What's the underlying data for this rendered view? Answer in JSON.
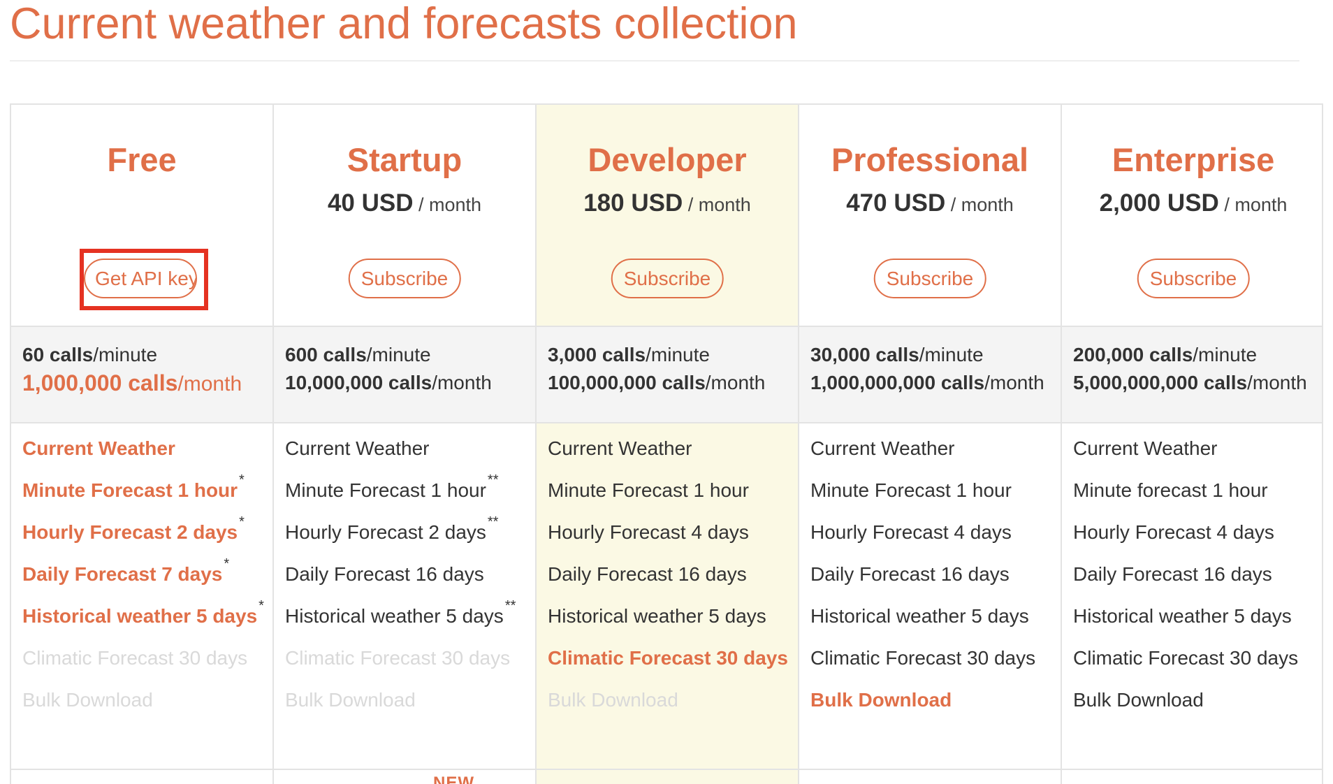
{
  "page": {
    "title": "Current weather and forecasts collection"
  },
  "colors": {
    "accent": "#e06f48",
    "featured_bg": "#fbf9e4",
    "highlight_box": "#e53222",
    "muted": "#d9d9d9"
  },
  "footer": {
    "badge": "NEW"
  },
  "plans": [
    {
      "name": "Free",
      "amount": "",
      "period": "",
      "button": "Get API key",
      "limits": [
        {
          "value": "60 calls",
          "unit": "/minute",
          "accent": false
        },
        {
          "value": "1,000,000 calls",
          "unit": "/month",
          "accent": true
        }
      ],
      "features": [
        {
          "text": "Current Weather",
          "mark": "",
          "state": "hl"
        },
        {
          "text": "Minute Forecast 1 hour",
          "mark": "*",
          "state": "hl"
        },
        {
          "text": "Hourly Forecast 2 days",
          "mark": "*",
          "state": "hl"
        },
        {
          "text": "Daily Forecast 7 days",
          "mark": "*",
          "state": "hl"
        },
        {
          "text": "Historical weather 5 days",
          "mark": "*",
          "state": "hl"
        },
        {
          "text": "Climatic Forecast 30 days",
          "mark": "",
          "state": "na"
        },
        {
          "text": "Bulk Download",
          "mark": "",
          "state": "na"
        }
      ]
    },
    {
      "name": "Startup",
      "amount": "40 USD",
      "period": "/ month",
      "button": "Subscribe",
      "limits": [
        {
          "value": "600 calls",
          "unit": "/minute",
          "accent": false
        },
        {
          "value": "10,000,000 calls",
          "unit": "/month",
          "accent": false
        }
      ],
      "features": [
        {
          "text": "Current Weather",
          "mark": "",
          "state": "ok"
        },
        {
          "text": "Minute Forecast 1 hour",
          "mark": "**",
          "state": "ok"
        },
        {
          "text": "Hourly Forecast 2 days",
          "mark": "**",
          "state": "ok"
        },
        {
          "text": "Daily Forecast 16 days",
          "mark": "",
          "state": "ok"
        },
        {
          "text": "Historical weather 5 days",
          "mark": "**",
          "state": "ok"
        },
        {
          "text": "Climatic Forecast 30 days",
          "mark": "",
          "state": "na"
        },
        {
          "text": "Bulk Download",
          "mark": "",
          "state": "na"
        }
      ]
    },
    {
      "name": "Developer",
      "amount": "180 USD",
      "period": "/ month",
      "button": "Subscribe",
      "limits": [
        {
          "value": "3,000 calls",
          "unit": "/minute",
          "accent": false
        },
        {
          "value": "100,000,000 calls",
          "unit": "/month",
          "accent": false
        }
      ],
      "features": [
        {
          "text": "Current Weather",
          "mark": "",
          "state": "ok"
        },
        {
          "text": "Minute Forecast 1 hour",
          "mark": "",
          "state": "ok"
        },
        {
          "text": "Hourly Forecast 4 days",
          "mark": "",
          "state": "ok"
        },
        {
          "text": "Daily Forecast 16 days",
          "mark": "",
          "state": "ok"
        },
        {
          "text": "Historical weather 5 days",
          "mark": "",
          "state": "ok"
        },
        {
          "text": "Climatic Forecast 30 days",
          "mark": "",
          "state": "hl"
        },
        {
          "text": "Bulk Download",
          "mark": "",
          "state": "na"
        }
      ]
    },
    {
      "name": "Professional",
      "amount": "470 USD",
      "period": "/ month",
      "button": "Subscribe",
      "limits": [
        {
          "value": "30,000 calls",
          "unit": "/minute",
          "accent": false
        },
        {
          "value": "1,000,000,000 calls",
          "unit": "/month",
          "accent": false
        }
      ],
      "features": [
        {
          "text": "Current Weather",
          "mark": "",
          "state": "ok"
        },
        {
          "text": "Minute Forecast 1 hour",
          "mark": "",
          "state": "ok"
        },
        {
          "text": "Hourly Forecast 4 days",
          "mark": "",
          "state": "ok"
        },
        {
          "text": "Daily Forecast 16 days",
          "mark": "",
          "state": "ok"
        },
        {
          "text": "Historical weather 5 days",
          "mark": "",
          "state": "ok"
        },
        {
          "text": "Climatic Forecast 30 days",
          "mark": "",
          "state": "ok"
        },
        {
          "text": "Bulk Download",
          "mark": "",
          "state": "hl"
        }
      ]
    },
    {
      "name": "Enterprise",
      "amount": "2,000 USD",
      "period": "/ month",
      "button": "Subscribe",
      "limits": [
        {
          "value": "200,000 calls",
          "unit": "/minute",
          "accent": false
        },
        {
          "value": "5,000,000,000 calls",
          "unit": "/month",
          "accent": false
        }
      ],
      "features": [
        {
          "text": "Current Weather",
          "mark": "",
          "state": "ok"
        },
        {
          "text": "Minute forecast 1 hour",
          "mark": "",
          "state": "ok"
        },
        {
          "text": "Hourly Forecast 4 days",
          "mark": "",
          "state": "ok"
        },
        {
          "text": "Daily Forecast 16 days",
          "mark": "",
          "state": "ok"
        },
        {
          "text": "Historical weather 5 days",
          "mark": "",
          "state": "ok"
        },
        {
          "text": "Climatic Forecast 30 days",
          "mark": "",
          "state": "ok"
        },
        {
          "text": "Bulk Download",
          "mark": "",
          "state": "ok"
        }
      ]
    }
  ]
}
